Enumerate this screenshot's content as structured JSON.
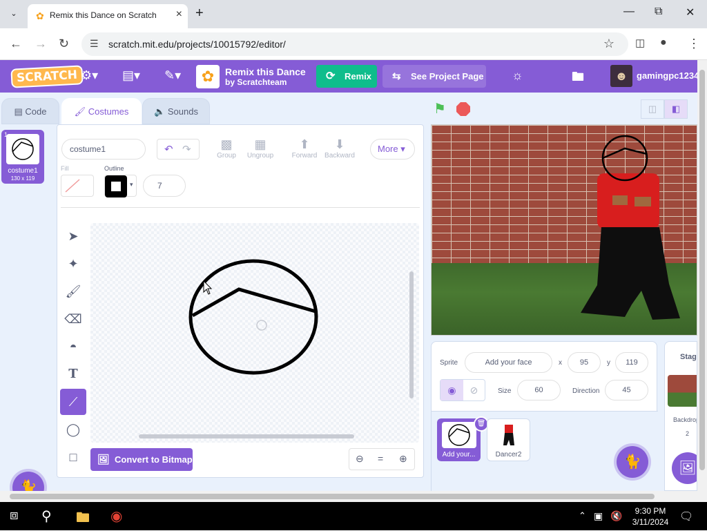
{
  "browser": {
    "tab_title": "Remix this Dance on Scratch",
    "url": "scratch.mit.edu/projects/10015792/editor/"
  },
  "menubar": {
    "logo": "SCRATCH",
    "project_title": "Remix this Dance",
    "project_author": "by Scratchteam",
    "remix_label": "Remix",
    "see_page_label": "See Project Page",
    "username": "gamingpc1234"
  },
  "tabs": [
    {
      "label": "Code",
      "active": false
    },
    {
      "label": "Costumes",
      "active": true
    },
    {
      "label": "Sounds",
      "active": false
    }
  ],
  "costumes": [
    {
      "number": "1",
      "name": "costume1",
      "size": "130 x 119"
    }
  ],
  "paint": {
    "costume_name": "costume1",
    "group": "Group",
    "ungroup": "Ungroup",
    "forward": "Forward",
    "backward": "Backward",
    "more": "More",
    "fill_label": "Fill",
    "outline_label": "Outline",
    "outline_width": "7",
    "convert_label": "Convert to Bitmap",
    "tools": [
      "select-icon",
      "reshape-icon",
      "brush-icon",
      "eraser-icon",
      "fill-icon",
      "text-icon",
      "line-icon",
      "circle-icon",
      "rectangle-icon"
    ],
    "active_tool": "line-icon"
  },
  "sprite": {
    "sprite_label": "Sprite",
    "name": "Add your face",
    "x_label": "x",
    "x": "95",
    "y_label": "y",
    "y": "119",
    "size_label": "Size",
    "size": "60",
    "direction_label": "Direction",
    "direction": "45",
    "list": [
      {
        "name": "Add your...",
        "selected": true
      },
      {
        "name": "Dancer2",
        "selected": false
      }
    ]
  },
  "stage": {
    "label": "Stage",
    "backdrops_label": "Backdrops",
    "backdrops_count": "2"
  },
  "taskbar": {
    "time": "9:30 PM",
    "date": "3/11/2024"
  },
  "colors": {
    "scratch_purple": "#855cd6",
    "remix_green": "#0fbd8c",
    "stop_red": "#ec5959"
  }
}
